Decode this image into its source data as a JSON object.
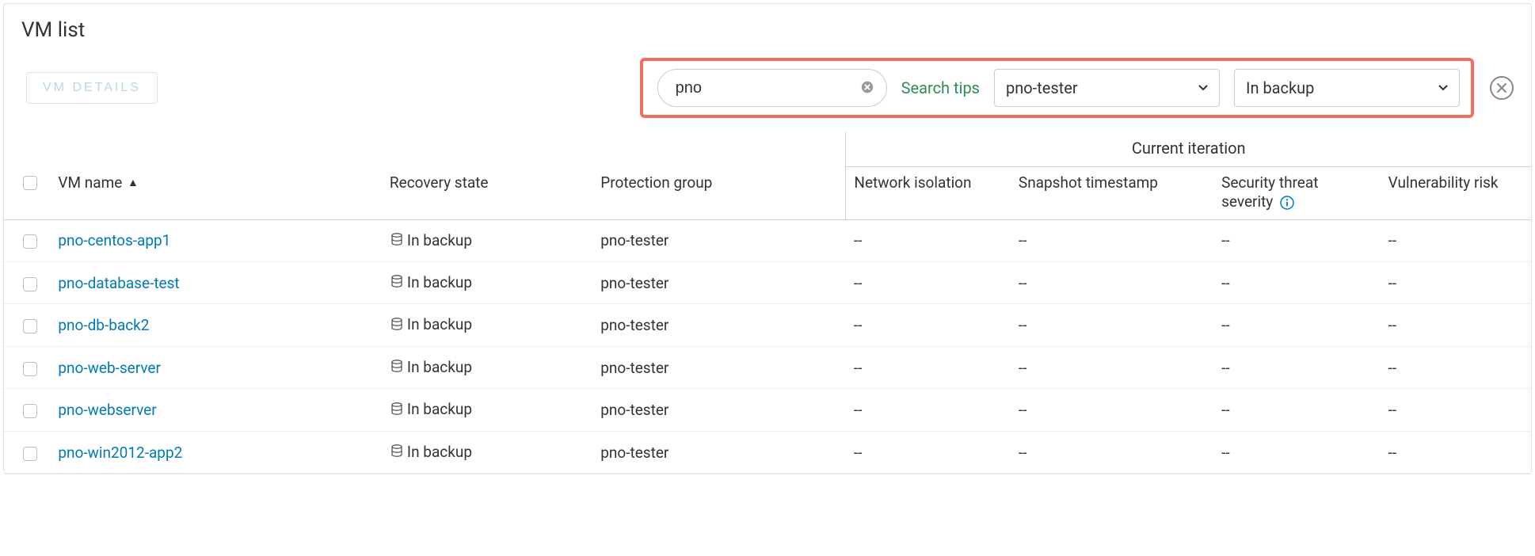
{
  "panel": {
    "title": "VM list"
  },
  "toolbar": {
    "vm_details_label": "VM DETAILS",
    "search_value": "pno",
    "search_tips_label": "Search tips",
    "filter1_value": "pno-tester",
    "filter2_value": "In backup"
  },
  "table": {
    "iteration_caption": "Current iteration",
    "columns": {
      "vm_name": "VM name",
      "recovery_state": "Recovery state",
      "protection_group": "Protection group",
      "network_isolation": "Network isolation",
      "snapshot_timestamp": "Snapshot timestamp",
      "security_severity": "Security threat severity",
      "vulnerability_risk": "Vulnerability risk"
    },
    "rows": [
      {
        "name": "pno-centos-app1",
        "recovery": "In backup",
        "protection": "pno-tester",
        "net": "--",
        "snap": "--",
        "sec": "--",
        "vuln": "--"
      },
      {
        "name": "pno-database-test",
        "recovery": "In backup",
        "protection": "pno-tester",
        "net": "--",
        "snap": "--",
        "sec": "--",
        "vuln": "--"
      },
      {
        "name": "pno-db-back2",
        "recovery": "In backup",
        "protection": "pno-tester",
        "net": "--",
        "snap": "--",
        "sec": "--",
        "vuln": "--"
      },
      {
        "name": "pno-web-server",
        "recovery": "In backup",
        "protection": "pno-tester",
        "net": "--",
        "snap": "--",
        "sec": "--",
        "vuln": "--"
      },
      {
        "name": "pno-webserver",
        "recovery": "In backup",
        "protection": "pno-tester",
        "net": "--",
        "snap": "--",
        "sec": "--",
        "vuln": "--"
      },
      {
        "name": "pno-win2012-app2",
        "recovery": "In backup",
        "protection": "pno-tester",
        "net": "--",
        "snap": "--",
        "sec": "--",
        "vuln": "--"
      }
    ]
  }
}
